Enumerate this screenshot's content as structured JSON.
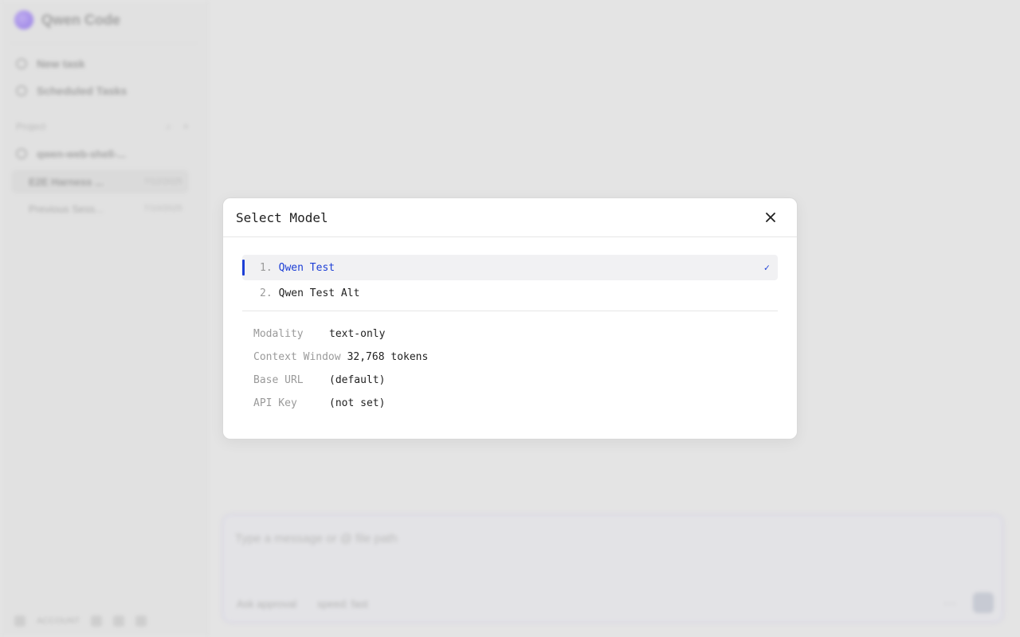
{
  "app": {
    "name": "Qwen Code"
  },
  "sidebar": {
    "nav": [
      {
        "label": "New task",
        "icon": "new-task-icon"
      },
      {
        "label": "Scheduled Tasks",
        "icon": "clock-icon"
      }
    ],
    "section_label": "Project",
    "project": {
      "name": "qwen-web-shell-..."
    },
    "sessions": [
      {
        "title": "E2E Harness ...",
        "time": "7/12/2025"
      },
      {
        "title": "Previous Sess...",
        "time": "7/10/2025"
      }
    ],
    "footer": {
      "account": "ACCOUNT"
    }
  },
  "composer": {
    "placeholder": "Type a message or @ file path",
    "approval_label": "Ask approval",
    "speed_label": "speed: fast",
    "more": "···"
  },
  "modal": {
    "title": "Select Model",
    "close_glyph": "×",
    "models": [
      {
        "number": "1.",
        "name": "Qwen Test",
        "selected": true,
        "check": "✓"
      },
      {
        "number": "2.",
        "name": "Qwen Test Alt",
        "selected": false,
        "check": ""
      }
    ],
    "details": [
      {
        "label": "Modality",
        "value": "text-only"
      },
      {
        "label": "Context Window",
        "value": "32,768 tokens"
      },
      {
        "label": "Base URL",
        "value": "(default)"
      },
      {
        "label": "API Key",
        "value": "(not set)"
      }
    ],
    "colors": {
      "accent": "#1d3fd6",
      "selected_bg": "#f1f1f3"
    }
  }
}
